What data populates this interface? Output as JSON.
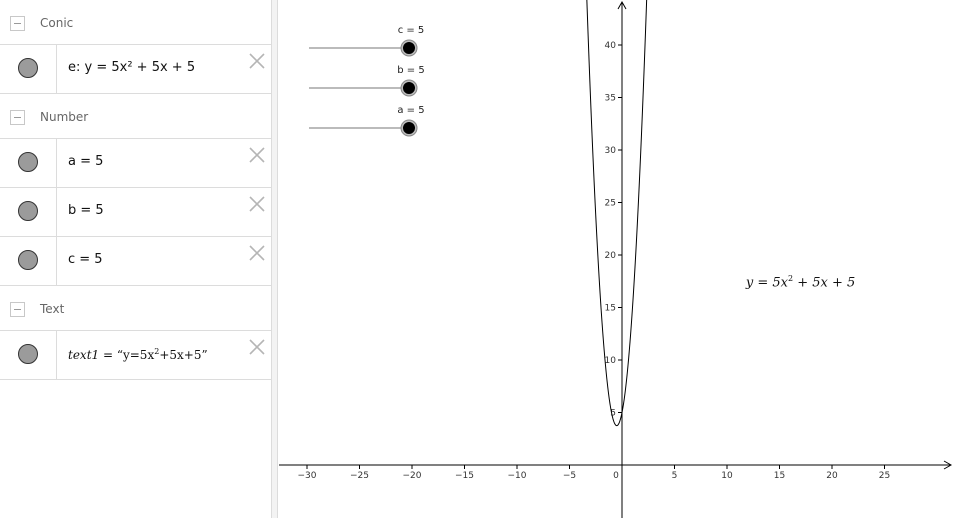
{
  "algebra": {
    "groups": [
      {
        "label": "Conic"
      },
      {
        "label": "Number"
      },
      {
        "label": "Text"
      }
    ],
    "items": [
      {
        "expr": "e: y = 5x² + 5x + 5"
      },
      {
        "expr": "a = 5"
      },
      {
        "expr": "b = 5"
      },
      {
        "expr": "c = 5"
      },
      {
        "expr_name": "text1",
        "expr_eq": " = “y=5x",
        "expr_sup": "2",
        "expr_rest": "+5x+5”"
      }
    ]
  },
  "sliders": [
    {
      "label": "c = 5",
      "value": 5
    },
    {
      "label": "b = 5",
      "value": 5
    },
    {
      "label": "a = 5",
      "value": 5
    }
  ],
  "graph": {
    "x_ticks": [
      "−30",
      "−25",
      "−20",
      "−15",
      "−10",
      "−5",
      "0",
      "5",
      "10",
      "15",
      "20",
      "25"
    ],
    "y_ticks": [
      "5",
      "10",
      "15",
      "20",
      "25",
      "30",
      "35",
      "40"
    ],
    "function": {
      "a": 5,
      "b": 5,
      "c": 5
    },
    "text_object": {
      "pre": "y = 5x",
      "sup": "2",
      "post": " + 5x + 5"
    }
  },
  "colors": {
    "marble": "#9b9b9b",
    "slider_point": "#000000",
    "curve": "#000000"
  }
}
